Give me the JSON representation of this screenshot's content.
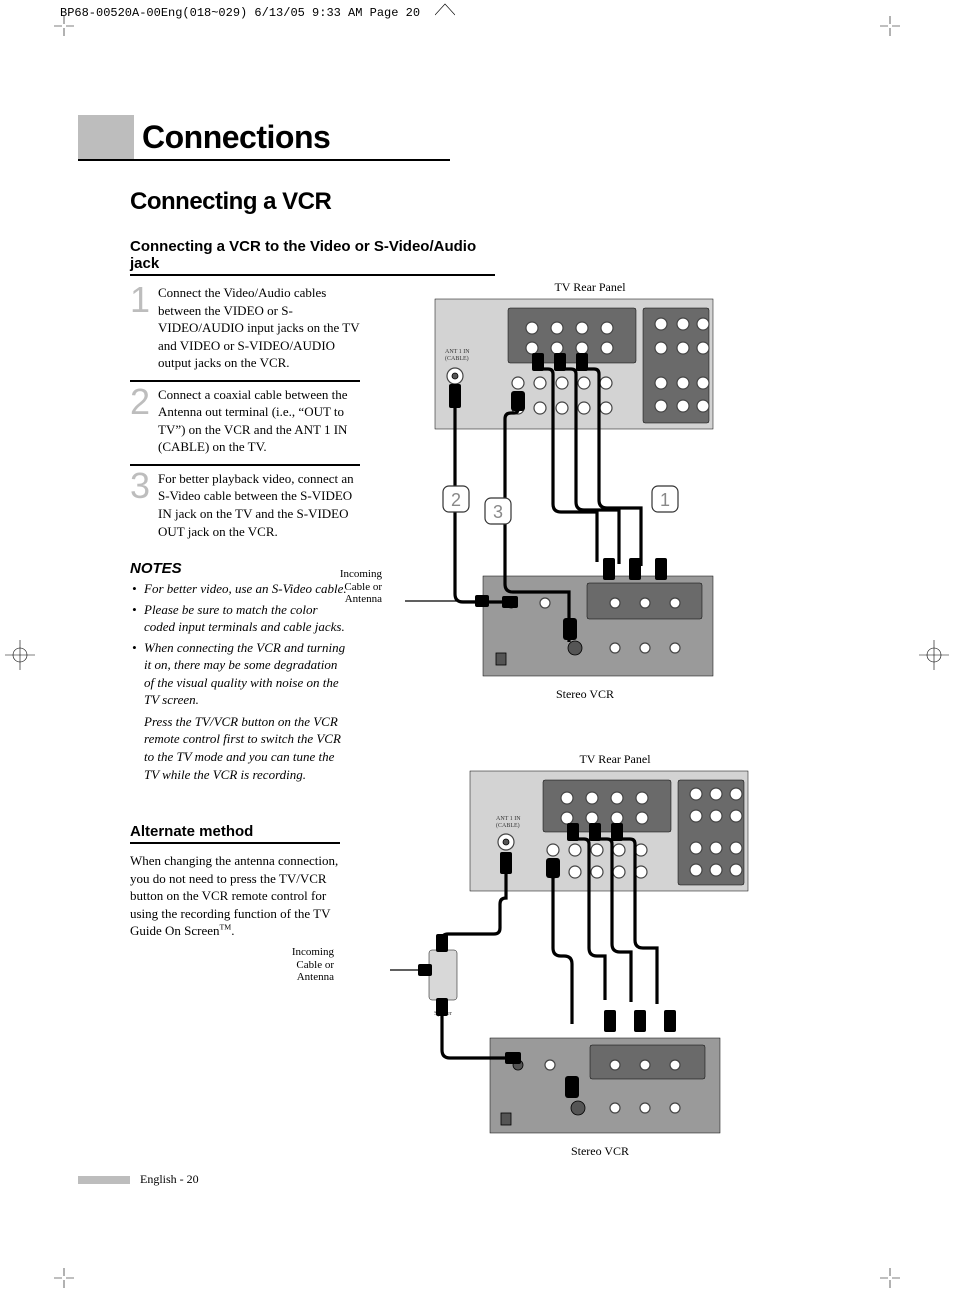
{
  "header": {
    "slug": "BP68-00520A-00Eng(018~029)  6/13/05  9:33 AM  Page 20"
  },
  "section_title": "Connections",
  "subsection_title": "Connecting a VCR",
  "subsub_title": "Connecting a VCR to the Video or S-Video/Audio jack",
  "steps": [
    {
      "n": "1",
      "text": "Connect the Video/Audio cables between the VIDEO or S-VIDEO/AUDIO input jacks on the TV and VIDEO or S-VIDEO/AUDIO output jacks on the VCR."
    },
    {
      "n": "2",
      "text": "Connect a coaxial cable between the Antenna out terminal (i.e., “OUT to TV”) on the VCR and the ANT 1 IN (CABLE) on the TV."
    },
    {
      "n": "3",
      "text": "For better playback video, connect an S-Video cable between the S-VIDEO IN jack on the TV and the S-VIDEO OUT jack on the VCR."
    }
  ],
  "notes_head": "NOTES",
  "notes": [
    {
      "text": "For better video, use an S-Video cable."
    },
    {
      "text": "Please be sure to match the color coded input terminals and cable jacks."
    },
    {
      "text": "When connecting the VCR and turning it on, there may be some degradation of the visual quality with noise on the TV screen.",
      "cont": "Press the TV/VCR button on the VCR remote control first to switch the VCR to the TV mode and you can tune the TV while the VCR is recording."
    }
  ],
  "alt_head": "Alternate method",
  "alt_body_pre": "When changing the antenna connection, you do not need to press the TV/VCR button on the VCR remote control for using the recording function of the TV Guide On Screen",
  "alt_body_post": ".",
  "fig_labels": {
    "tv_rear": "TV Rear Panel",
    "stereo_vcr": "Stereo VCR",
    "incoming": "Incoming Cable or Antenna",
    "ant_label": "ANT 1 IN (CABLE)",
    "splitter": "Splitter",
    "callout_1": "1",
    "callout_2": "2",
    "callout_3": "3"
  },
  "footer": {
    "lang": "English - 20"
  }
}
